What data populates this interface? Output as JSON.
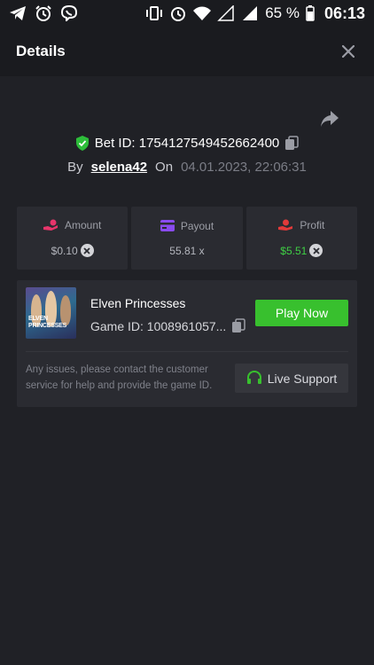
{
  "status_bar": {
    "battery_percent": "65 %",
    "time": "06:13"
  },
  "header": {
    "title": "Details"
  },
  "bet": {
    "id_label": "Bet ID: 1754127549452662400",
    "by_label": "By",
    "username": "selena42",
    "on_label": "On",
    "date": "04.01.2023, 22:06:31"
  },
  "stats": {
    "amount": {
      "label": "Amount",
      "value": "$0.10"
    },
    "payout": {
      "label": "Payout",
      "value": "55.81 x"
    },
    "profit": {
      "label": "Profit",
      "value": "$5.51"
    }
  },
  "game": {
    "thumb_text_1": "ELVEN",
    "thumb_text_2": "PRINCESSES",
    "name": "Elven Princesses",
    "id_label": "Game ID: 1008961057...",
    "play_label": "Play Now",
    "issues_text": "Any issues, please contact the customer service for help and provide the game ID.",
    "support_label": "Live Support"
  },
  "colors": {
    "accent_green": "#38c02e",
    "profit_green": "#3fd044",
    "amount_icon": "#e8356b",
    "payout_icon": "#8a4bf0",
    "profit_icon": "#e23a3a"
  }
}
